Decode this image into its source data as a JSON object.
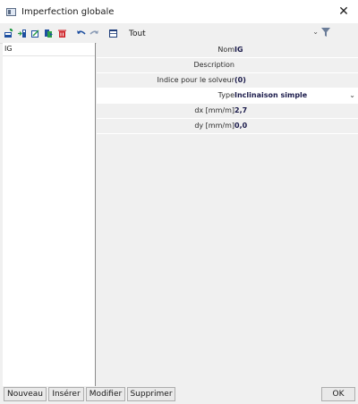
{
  "window": {
    "title": "Imperfection globale",
    "close_glyph": "✕"
  },
  "toolbar": {
    "icons": [
      "new-icon",
      "insert-icon",
      "edit-icon",
      "copy-icon",
      "delete-icon",
      "undo-icon",
      "redo-icon",
      "table-icon"
    ],
    "filter_label": "Tout",
    "filter_chevron": "⌄",
    "funnel_icon": "funnel-icon"
  },
  "list": {
    "items": [
      "IG"
    ]
  },
  "properties": [
    {
      "label": "Nom",
      "value": "IG"
    },
    {
      "label": "Description",
      "value": ""
    },
    {
      "label": "Indice pour le solveur",
      "value": "(0)"
    },
    {
      "label": "Type",
      "value": "Inclinaison simple"
    },
    {
      "label": "dx [mm/m]",
      "value": "2,7"
    },
    {
      "label": "dy [mm/m]",
      "value": "0,0"
    }
  ],
  "buttons": {
    "new": "Nouveau",
    "insert": "Insérer",
    "modify": "Modifier",
    "delete": "Supprimer",
    "ok": "OK"
  },
  "colors": {
    "accent_blue": "#1e4fa0",
    "accent_red": "#d0282e",
    "accent_green": "#2a9d4a",
    "funnel": "#6b7d99"
  }
}
